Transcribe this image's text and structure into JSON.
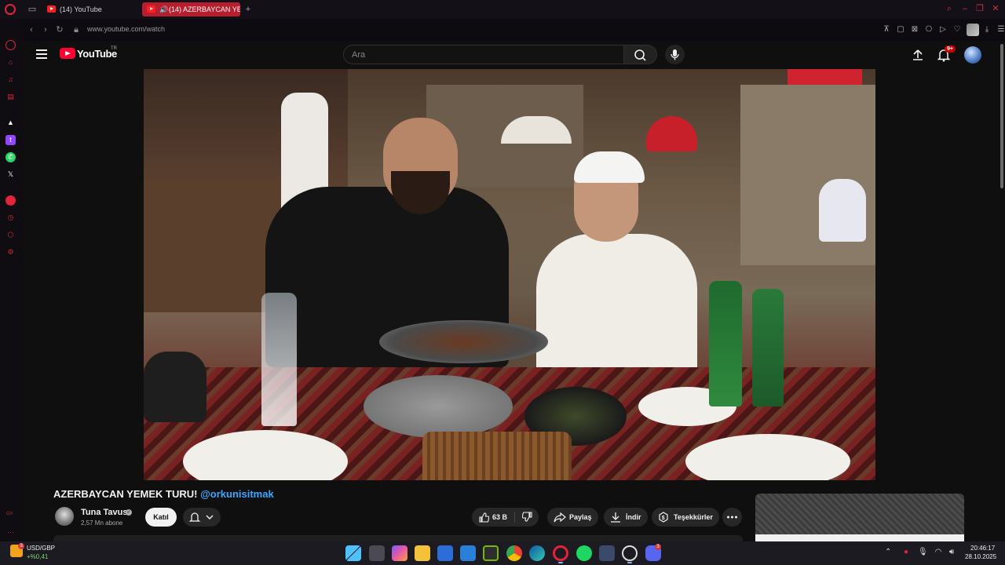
{
  "browser": {
    "tabs": [
      {
        "label": "(14) YouTube"
      },
      {
        "label": "(14) AZERBAYCAN YE"
      }
    ],
    "url": "www.youtube.com/watch",
    "sidebar_footer": "GX"
  },
  "youtube": {
    "logo_text": "YouTube",
    "country_code": "TR",
    "search_placeholder": "Ara",
    "notification_count": "9+"
  },
  "video": {
    "title": "AZERBAYCAN YEMEK TURU!",
    "title_tag": "@orkunisitmak",
    "channel_name": "Tuna Tavus",
    "subscribers": "2,57 Mn abone",
    "join_label": "Katıl",
    "like_count": "63 B",
    "share_label": "Paylaş",
    "download_label": "İndir",
    "thanks_label": "Teşekkürler"
  },
  "taskbar": {
    "ticker_label": "USD/GBP",
    "ticker_value": "+%0,41",
    "ticker_badge": "3",
    "discord_badge": "3",
    "time": "20:46:17",
    "date": "28.10.2025"
  },
  "colors": {
    "accent": "#e0243a",
    "youtube_red": "#ff0033",
    "link_blue": "#3ea6ff",
    "page_bg": "#0f0f0f"
  }
}
